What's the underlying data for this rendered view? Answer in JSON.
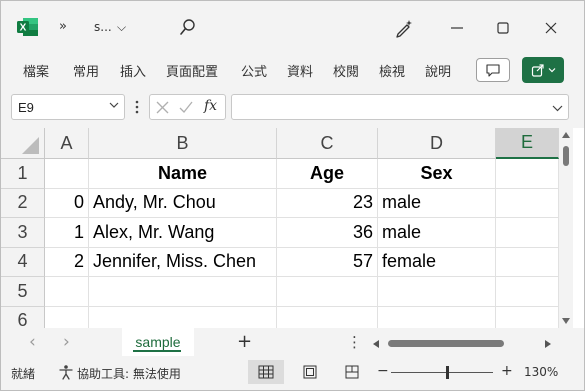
{
  "titlebar": {
    "app_icon_letter": "X",
    "more_glyph": "»",
    "file_name": "s...",
    "chevron": "⌵"
  },
  "menu": {
    "items": [
      "檔案",
      "常用",
      "插入",
      "頁面配置",
      "公式",
      "資料",
      "校閱",
      "檢視",
      "說明"
    ]
  },
  "formula_bar": {
    "name_box": "E9",
    "fx": "fx",
    "value": ""
  },
  "sheet": {
    "columns": [
      "A",
      "B",
      "C",
      "D",
      "E"
    ],
    "active_column": "E",
    "rows": [
      "1",
      "2",
      "3",
      "4",
      "5",
      "6"
    ],
    "header": {
      "b": "Name",
      "c": "Age",
      "d": "Sex"
    },
    "data": [
      {
        "a": "0",
        "b": "Andy, Mr. Chou",
        "c": "23",
        "d": "male"
      },
      {
        "a": "1",
        "b": "Alex, Mr. Wang",
        "c": "36",
        "d": "male"
      },
      {
        "a": "2",
        "b": "Jennifer, Miss. Chen",
        "c": "57",
        "d": "female"
      }
    ]
  },
  "tabs": {
    "sheet_name": "sample",
    "add": "+",
    "prev": "‹",
    "next": "›",
    "menu": "⋮"
  },
  "status": {
    "ready": "就緒",
    "accessibility": "協助工具: 無法使用",
    "zoom": "130%",
    "zoom_minus": "−",
    "zoom_plus": "+"
  }
}
